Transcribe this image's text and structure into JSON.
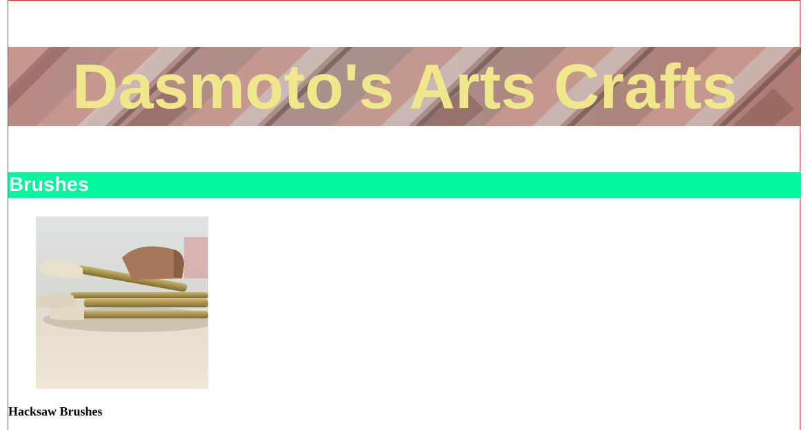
{
  "header": {
    "title": "Dasmoto's Arts Crafts",
    "title_color": "#f0e68c"
  },
  "sections": [
    {
      "heading": "Brushes",
      "bar_color": "#00f79b",
      "items": [
        {
          "caption": "Hacksaw Brushes",
          "image": "paintbrushes-photo"
        }
      ]
    }
  ]
}
